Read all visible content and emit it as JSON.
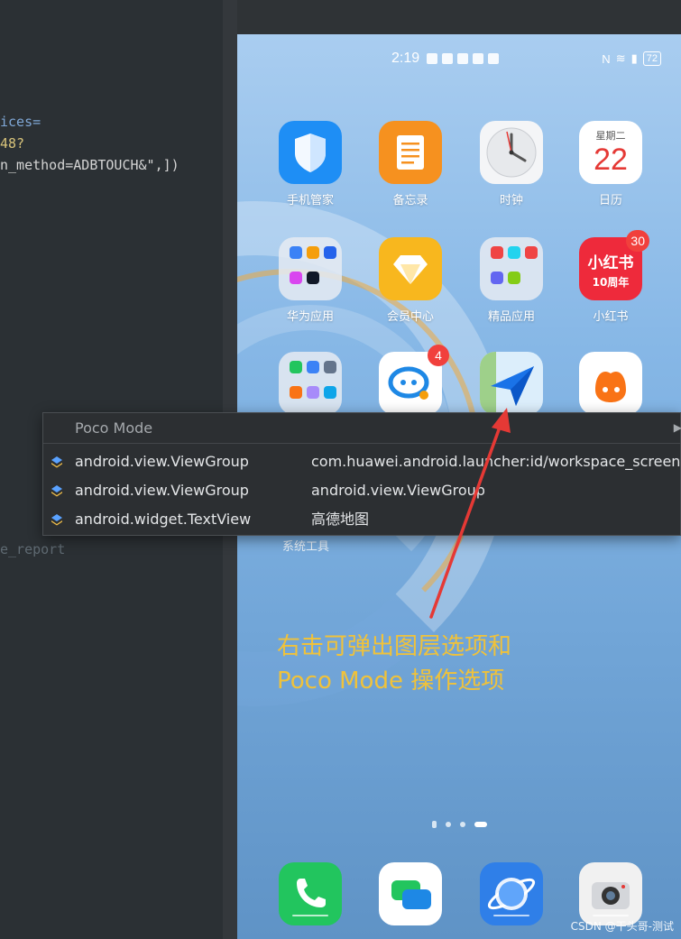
{
  "editor": {
    "lines": [
      "ices=",
      "48?",
      "n_method=ADBTOUCH&\",])",
      "e_report"
    ]
  },
  "status_bar": {
    "time": "2:19",
    "battery": "72"
  },
  "apps": [
    {
      "label": "手机管家",
      "icon": "phone-manager-icon",
      "color": "#1e8ef5"
    },
    {
      "label": "备忘录",
      "icon": "notes-icon",
      "color": "#f6911f"
    },
    {
      "label": "时钟",
      "icon": "clock-icon",
      "color": "#ffffff"
    },
    {
      "label": "日历",
      "icon": "calendar-icon",
      "color": "#ffffff",
      "day": "星期二",
      "date": "22"
    },
    {
      "label": "华为应用",
      "icon": "folder-icon",
      "color": "#e6ebf2"
    },
    {
      "label": "会员中心",
      "icon": "member-center-icon",
      "color": "#f8b71e"
    },
    {
      "label": "精品应用",
      "icon": "folder-icon",
      "color": "#e6ebf2"
    },
    {
      "label": "小红书",
      "icon": "xiaohongshu-icon",
      "color": "#ee2a3b",
      "badge": "30",
      "title": "小红书",
      "subtitle": "10周年"
    },
    {
      "label": "",
      "icon": "folder-icon",
      "color": "#e6ebf2"
    },
    {
      "label": "",
      "icon": "chat-icon",
      "color": "#ffffff",
      "badge": "4"
    },
    {
      "label": "",
      "icon": "amap-icon",
      "color": "#dceefb"
    },
    {
      "label": "",
      "icon": "game-center-icon",
      "color": "#ffffff"
    }
  ],
  "hidden_label": "系统工具",
  "callout": {
    "line1": "右击可弹出图层选项和",
    "line2": "Poco Mode 操作选项"
  },
  "dock": [
    {
      "icon": "phone-icon",
      "color": "#22c55e"
    },
    {
      "icon": "messages-icon",
      "color": "#ffffff"
    },
    {
      "icon": "browser-icon",
      "color": "#2f7fe8"
    },
    {
      "icon": "camera-icon",
      "color": "#f1f1f1"
    }
  ],
  "context_menu": {
    "title": "Poco Mode",
    "rows": [
      {
        "class": "android.view.ViewGroup",
        "name": "com.huawei.android.launcher:id/workspace_screen"
      },
      {
        "class": "android.view.ViewGroup",
        "name": "android.view.ViewGroup"
      },
      {
        "class": "android.widget.TextView",
        "name": "高德地图"
      }
    ]
  },
  "watermark": "CSDN @干头哥-测试",
  "colors": {
    "callout": "#f0c23a",
    "arrow": "#e53935",
    "badge": "#f1403c",
    "editor_bg": "#2b3034"
  }
}
